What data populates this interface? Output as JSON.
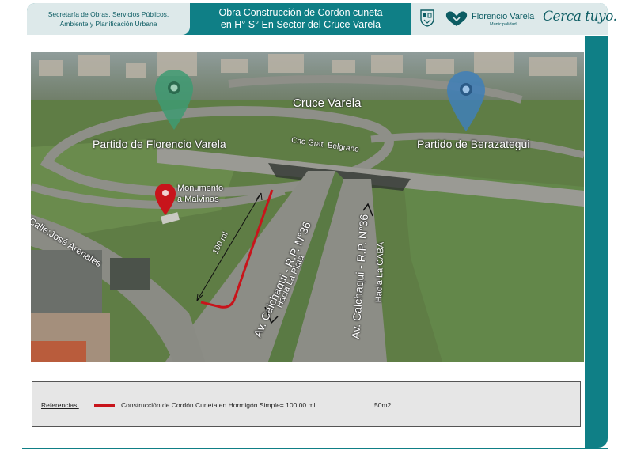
{
  "header": {
    "org_line1": "Secretaría de Obras, Servicios Públicos,",
    "org_line2": "Ambiente y Planificación Urbana",
    "title_line1": "Obra Construcción de Cordon cuneta",
    "title_line2": "en H° S° En Sector del Cruce Varela",
    "brand_name": "Florencio Varela",
    "brand_sub": "Municipalidad",
    "slogan": "Cerca tuyo."
  },
  "map": {
    "cruce": "Cruce Varela",
    "partido_left": "Partido de Florencio Varela",
    "partido_right": "Partido de Berazategui",
    "camino": "Cno Grat. Belgrano",
    "monumento_1": "Monumento",
    "monumento_2": "a Malvinas",
    "calle": "Calle:José Arenales",
    "distance": "100 ml",
    "av_left": "Av. Calchaqui - R.P. N°36",
    "dir_left": "Hacia La Plata",
    "av_right": "Av. Calchaqui - R.P. N°36",
    "dir_right": "Hacia La CABA"
  },
  "references": {
    "title": "Referencias:",
    "description": "Construcción de Cordón Cuneta  en Hormigón Simple= 100,00 ml",
    "area": "50m2"
  },
  "colors": {
    "brand_teal": "#0f7f86",
    "pin_green": "#3e9a72",
    "pin_blue": "#3f7fb8",
    "pin_red": "#c8141b",
    "curb_line": "#c8141b"
  },
  "icons": [
    "crest-icon",
    "heart-hands-icon",
    "location-pin-icon",
    "arrow-down-icon",
    "arrow-up-icon"
  ]
}
